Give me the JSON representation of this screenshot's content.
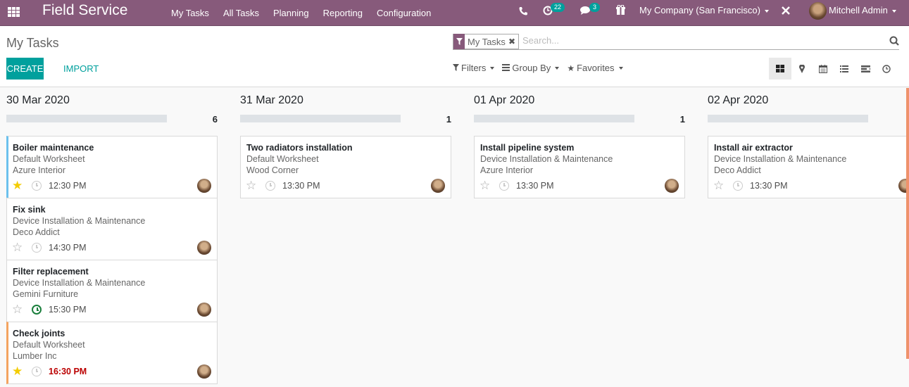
{
  "navbar": {
    "brand": "Field Service",
    "menu": [
      "My Tasks",
      "All Tasks",
      "Planning",
      "Reporting",
      "Configuration"
    ],
    "activity_badge": "22",
    "messages_badge": "3",
    "company": "My Company (San Francisco)",
    "user": "Mitchell Admin"
  },
  "control_panel": {
    "title": "My Tasks",
    "create_label": "CREATE",
    "import_label": "IMPORT",
    "facet_label": "My Tasks",
    "search_placeholder": "Search...",
    "filters_label": "Filters",
    "groupby_label": "Group By",
    "favorites_label": "Favorites",
    "views": [
      "kanban",
      "map",
      "calendar",
      "list",
      "gantt",
      "activity"
    ],
    "active_view": "kanban"
  },
  "columns": [
    {
      "title": "30 Mar 2020",
      "count": "6",
      "cards": [
        {
          "title": "Boiler maintenance",
          "worksheet": "Default Worksheet",
          "customer": "Azure Interior",
          "time": "12:30 PM",
          "starred": true,
          "color": "blue",
          "activity": "none",
          "overdue": false
        },
        {
          "title": "Fix sink",
          "worksheet": "Device Installation & Maintenance",
          "customer": "Deco Addict",
          "time": "14:30 PM",
          "starred": false,
          "color": "none",
          "activity": "none",
          "overdue": false
        },
        {
          "title": "Filter replacement",
          "worksheet": "Device Installation & Maintenance",
          "customer": "Gemini Furniture",
          "time": "15:30 PM",
          "starred": false,
          "color": "none",
          "activity": "planned",
          "overdue": false
        },
        {
          "title": "Check joints",
          "worksheet": "Default Worksheet",
          "customer": "Lumber Inc",
          "time": "16:30 PM",
          "starred": true,
          "color": "orange",
          "activity": "none",
          "overdue": true
        }
      ]
    },
    {
      "title": "31 Mar 2020",
      "count": "1",
      "cards": [
        {
          "title": "Two radiators installation",
          "worksheet": "Default Worksheet",
          "customer": "Wood Corner",
          "time": "13:30 PM",
          "starred": false,
          "color": "none",
          "activity": "none",
          "overdue": false
        }
      ]
    },
    {
      "title": "01 Apr 2020",
      "count": "1",
      "cards": [
        {
          "title": "Install pipeline system",
          "worksheet": "Device Installation & Maintenance",
          "customer": "Azure Interior",
          "time": "13:30 PM",
          "starred": false,
          "color": "none",
          "activity": "none",
          "overdue": false
        }
      ]
    },
    {
      "title": "02 Apr 2020",
      "count": "",
      "cards": [
        {
          "title": "Install air extractor",
          "worksheet": "Device Installation & Maintenance",
          "customer": "Deco Addict",
          "time": "13:30 PM",
          "starred": false,
          "color": "none",
          "activity": "none",
          "overdue": false
        }
      ]
    }
  ]
}
